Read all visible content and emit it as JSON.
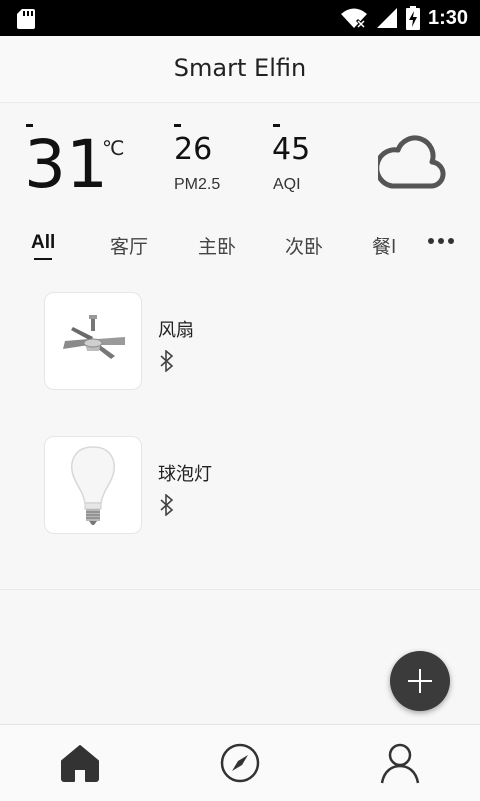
{
  "status_bar": {
    "time": "1:30"
  },
  "app": {
    "title": "Smart Elfin"
  },
  "weather": {
    "temperature": "31",
    "temperature_unit": "℃",
    "pm25_value": "26",
    "pm25_label": "PM2.5",
    "aqi_value": "45",
    "aqi_label": "AQI",
    "condition_icon": "cloud-icon"
  },
  "tabs": [
    {
      "label": "All",
      "active": true
    },
    {
      "label": "客厅"
    },
    {
      "label": "主卧"
    },
    {
      "label": "次卧"
    },
    {
      "label": "餐l"
    }
  ],
  "devices": [
    {
      "name": "风扇",
      "icon": "ceiling-fan-image",
      "connection": "bluetooth-icon"
    },
    {
      "name": "球泡灯",
      "icon": "light-bulb-image",
      "connection": "bluetooth-icon"
    }
  ],
  "bottom_nav": [
    {
      "name": "home-icon",
      "active": true
    },
    {
      "name": "compass-icon"
    },
    {
      "name": "profile-icon"
    }
  ],
  "colors": {
    "accent": "#3b3b3b",
    "background": "#f7f7f7"
  }
}
